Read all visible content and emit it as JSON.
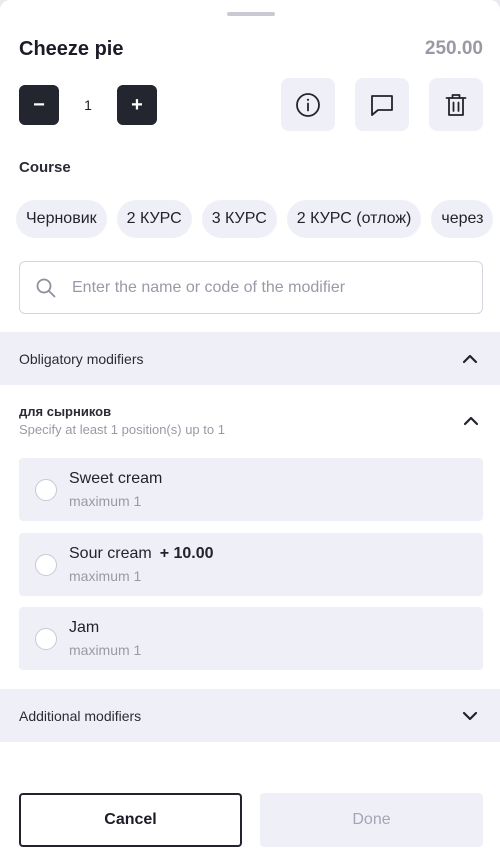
{
  "item": {
    "title": "Cheeze pie",
    "price": "250.00"
  },
  "quantity": {
    "value": "1",
    "minus": "−",
    "plus": "+"
  },
  "course": {
    "label": "Course",
    "chips": [
      "Черновик",
      "2 КУРС",
      "3 КУРС",
      "2 КУРС (отлож)",
      "через"
    ]
  },
  "search": {
    "placeholder": "Enter the name or code of the modifier"
  },
  "obligatory": {
    "label": "Obligatory modifiers",
    "group": {
      "title": "для сырников",
      "subtitle": "Specify at least 1 position(s)  up to 1",
      "options": [
        {
          "name": "Sweet cream",
          "price": "",
          "limit": "maximum 1"
        },
        {
          "name": "Sour cream",
          "price": "+ 10.00",
          "limit": "maximum 1"
        },
        {
          "name": "Jam",
          "price": "",
          "limit": "maximum 1"
        }
      ]
    }
  },
  "additional": {
    "label": "Additional modifiers"
  },
  "footer": {
    "cancel": "Cancel",
    "done": "Done"
  },
  "icons": {
    "info": "info-icon",
    "comment": "comment-icon",
    "delete": "trash-icon",
    "search": "search-icon",
    "collapse": "chevron-up-icon",
    "expand": "chevron-down-icon"
  },
  "colors": {
    "dark": "#23262f",
    "surface": "#eff0f7",
    "muted": "#9a9aa6"
  }
}
